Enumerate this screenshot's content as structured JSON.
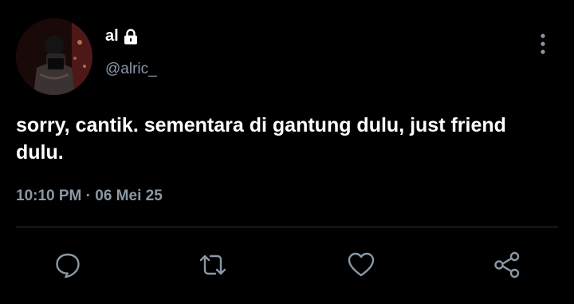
{
  "user": {
    "display_name": "al",
    "handle": "@alric_",
    "avatar_icon": "profile-photo",
    "lock_icon": "lock-icon"
  },
  "tweet": {
    "text": "sorry, cantik. sementara di gantung dulu, just friend dulu.",
    "timestamp": "10:10 PM · 06 Mei 25"
  },
  "actions": [
    {
      "name": "reply",
      "icon": "speech-bubble-icon"
    },
    {
      "name": "retweet",
      "icon": "retweet-icon"
    },
    {
      "name": "like",
      "icon": "heart-icon"
    },
    {
      "name": "share",
      "icon": "share-icon"
    }
  ],
  "colors": {
    "background": "#000000",
    "text": "#ffffff",
    "muted": "#8b98a5",
    "divider": "#2f3336"
  }
}
